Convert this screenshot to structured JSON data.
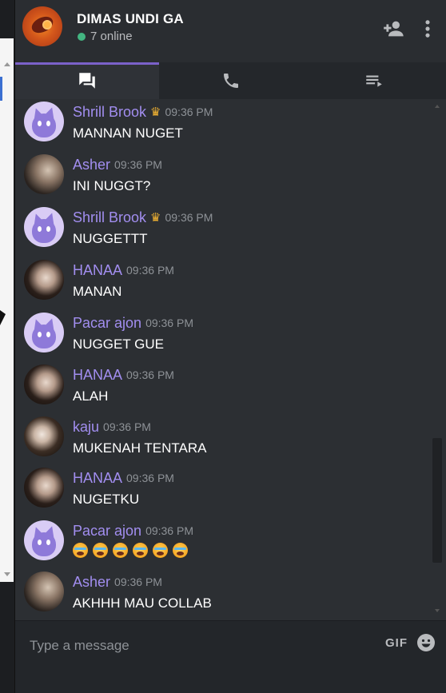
{
  "header": {
    "group_name": "DIMAS UNDI GA",
    "online_status": "7 online",
    "add_user_icon": "add-user-icon",
    "more_icon": "more-vertical-icon"
  },
  "tabs": [
    {
      "name": "chat",
      "icon": "chat-icon",
      "active": true
    },
    {
      "name": "call",
      "icon": "phone-icon",
      "active": false
    },
    {
      "name": "members",
      "icon": "playlist-icon",
      "active": false
    }
  ],
  "colors": {
    "accent": "#7b61c9",
    "username": "#a28ef0",
    "online": "#43b581",
    "crown": "#f0b232"
  },
  "messages": [
    {
      "author": "Shrill Brook",
      "crown": true,
      "time": "09:36 PM",
      "text": "MANNAN NUGET",
      "avatar": "purple-cat"
    },
    {
      "author": "Asher",
      "crown": false,
      "time": "09:36 PM",
      "text": "INI NUGGT?",
      "avatar": "photo-asher"
    },
    {
      "author": "Shrill Brook",
      "crown": true,
      "time": "09:36 PM",
      "text": "NUGGETTT",
      "avatar": "purple-cat"
    },
    {
      "author": "HANAA",
      "crown": false,
      "time": "09:36 PM",
      "text": "MANAN",
      "avatar": "photo-hanaa"
    },
    {
      "author": "Pacar ajon",
      "crown": false,
      "time": "09:36 PM",
      "text": "NUGGET GUE",
      "avatar": "purple-cat"
    },
    {
      "author": "HANAA",
      "crown": false,
      "time": "09:36 PM",
      "text": "ALAH",
      "avatar": "photo-hanaa"
    },
    {
      "author": "kaju",
      "crown": false,
      "time": "09:36 PM",
      "text": "MUKENAH TENTARA",
      "avatar": "photo-kaju"
    },
    {
      "author": "HANAA",
      "crown": false,
      "time": "09:36 PM",
      "text": "NUGETKU",
      "avatar": "photo-hanaa"
    },
    {
      "author": "Pacar ajon",
      "crown": false,
      "time": "09:36 PM",
      "text": "",
      "emoji_count": 6,
      "emoji": "loudly-crying-face",
      "avatar": "purple-cat"
    },
    {
      "author": "Asher",
      "crown": false,
      "time": "09:36 PM",
      "text": "AKHHH MAU COLLAB",
      "avatar": "photo-asher"
    }
  ],
  "composer": {
    "placeholder": "Type a message",
    "gif_label": "GIF",
    "emoji_icon": "smile-icon"
  }
}
